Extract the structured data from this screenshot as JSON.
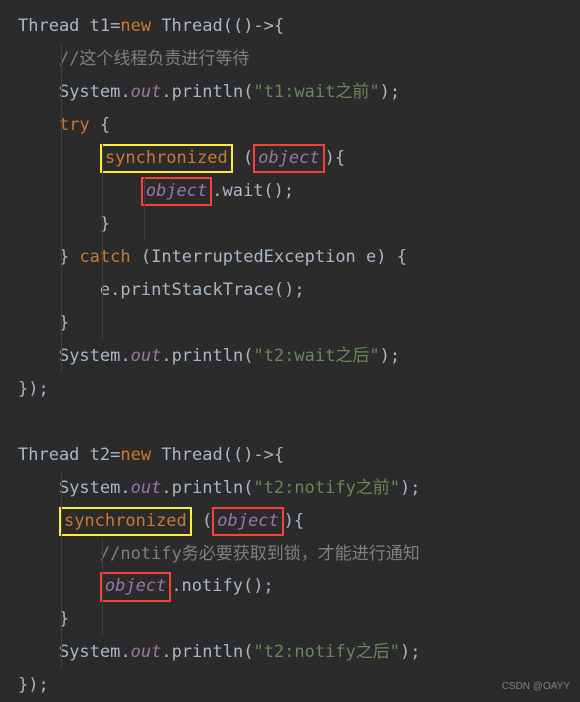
{
  "code": {
    "l1_a": "Thread t1=",
    "l1_new": "new ",
    "l1_b": "Thread(()->{",
    "l2_comment": "//这个线程负责进行等待",
    "l3_a": "System.",
    "l3_out": "out",
    "l3_b": ".println(",
    "l3_str": "\"t1:wait之前\"",
    "l3_c": ");",
    "l4_try": "try ",
    "l4_b": "{",
    "l5_sync": "synchronized",
    "l5_sp": " (",
    "l5_obj": "object",
    "l5_b": "){",
    "l6_obj": "object",
    "l6_b": ".wait();",
    "l7": "}",
    "l8_a": "} ",
    "l8_catch": "catch ",
    "l8_b": "(InterruptedException e) {",
    "l9": "e.printStackTrace();",
    "l10": "}",
    "l11_a": "System.",
    "l11_out": "out",
    "l11_b": ".println(",
    "l11_str": "\"t2:wait之后\"",
    "l11_c": ");",
    "l12": "});",
    "l14_a": "Thread t2=",
    "l14_new": "new ",
    "l14_b": "Thread(()->{",
    "l15_a": "System.",
    "l15_out": "out",
    "l15_b": ".println(",
    "l15_str": "\"t2:notify之前\"",
    "l15_c": ");",
    "l16_sync": "synchronized",
    "l16_sp": " (",
    "l16_obj": "object",
    "l16_b": "){",
    "l17_comment": "//notify务必要获取到锁，才能进行通知",
    "l18_obj": "object",
    "l18_b": ".notify();",
    "l19": "}",
    "l20_a": "System.",
    "l20_out": "out",
    "l20_b": ".println(",
    "l20_str": "\"t2:notify之后\"",
    "l20_c": ");",
    "l21": "});"
  },
  "watermark": "CSDN @OAYY"
}
